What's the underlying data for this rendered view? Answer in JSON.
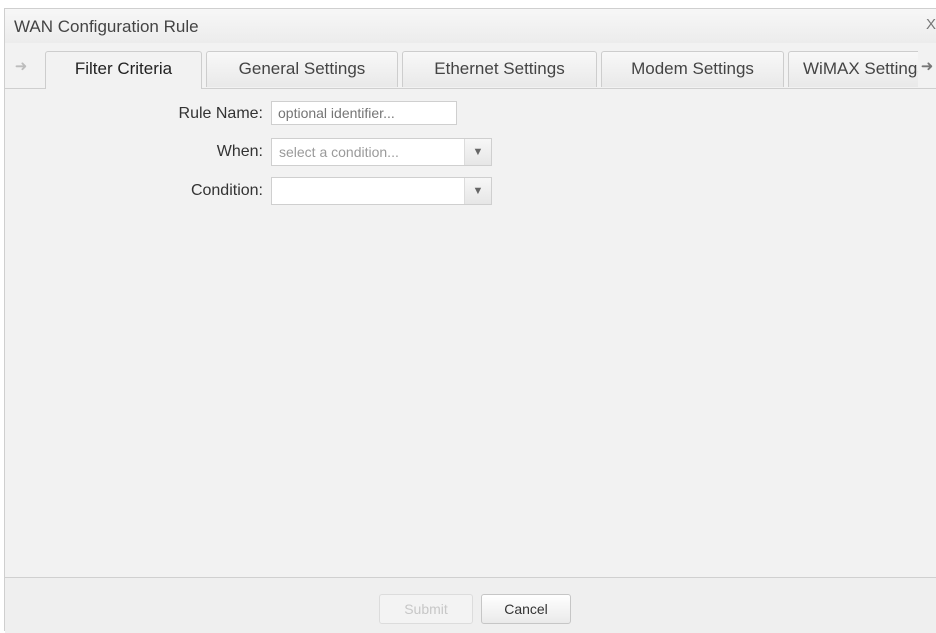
{
  "window": {
    "title": "WAN Configuration Rule",
    "close_glyph": "X"
  },
  "tabs": [
    {
      "label": "Filter Criteria",
      "active": true
    },
    {
      "label": "General Settings",
      "active": false
    },
    {
      "label": "Ethernet Settings",
      "active": false
    },
    {
      "label": "Modem Settings",
      "active": false
    },
    {
      "label": "WiMAX Settings",
      "active": false
    }
  ],
  "tab_scroll": {
    "left_icon": "arrow-left-icon",
    "right_icon": "arrow-right-icon"
  },
  "form": {
    "rule_name": {
      "label": "Rule Name:",
      "value": "",
      "placeholder": "optional identifier..."
    },
    "when": {
      "label": "When:",
      "selected": "select a condition..."
    },
    "condition": {
      "label": "Condition:",
      "selected": ""
    }
  },
  "footer": {
    "submit_label": "Submit",
    "submit_enabled": false,
    "cancel_label": "Cancel"
  }
}
